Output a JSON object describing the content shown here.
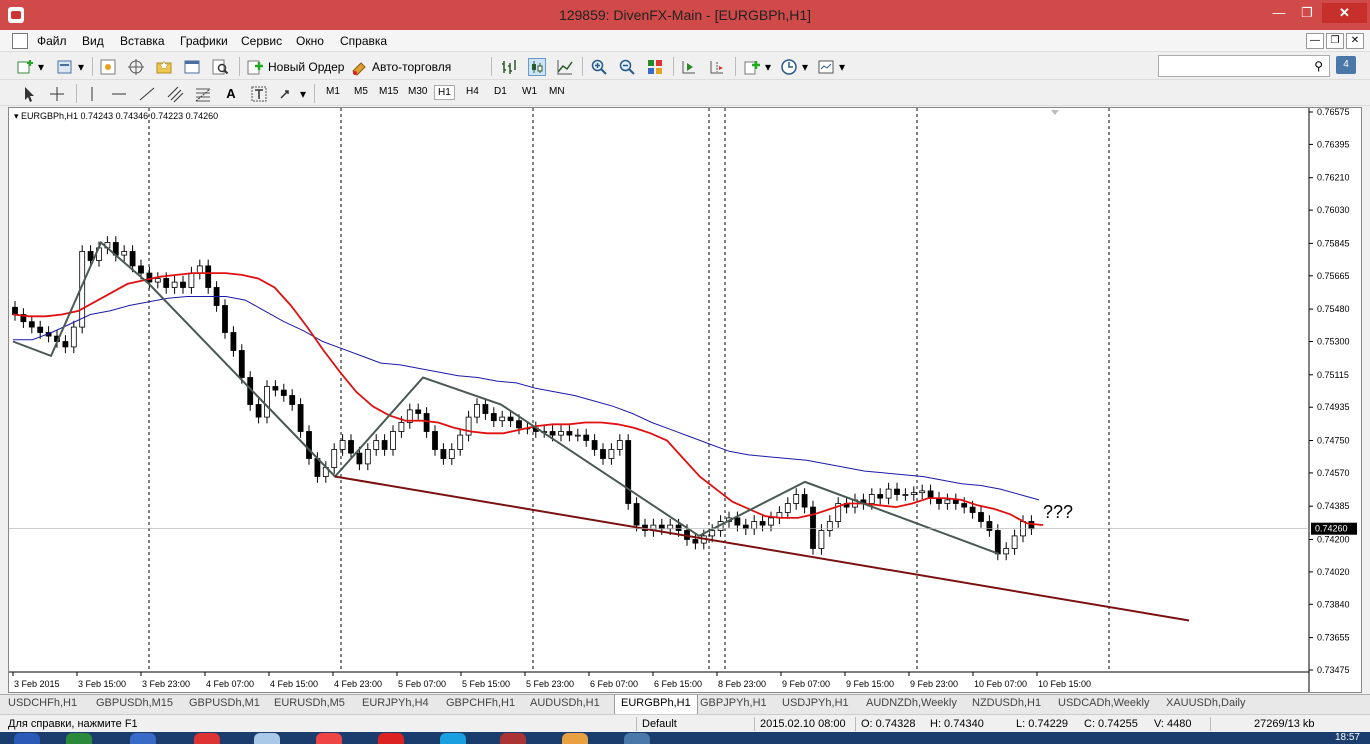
{
  "window": {
    "title": "129859: DivenFX-Main - [EURGBPh,H1]"
  },
  "menu": [
    "Файл",
    "Вид",
    "Вставка",
    "Графики",
    "Сервис",
    "Окно",
    "Справка"
  ],
  "toolbar": {
    "new_order": "Новый Ордер",
    "auto_trading": "Авто-торговля",
    "notification_count": "4"
  },
  "timeframes": [
    "M1",
    "M5",
    "M15",
    "M30",
    "H1",
    "H4",
    "D1",
    "W1",
    "MN"
  ],
  "active_timeframe": "H1",
  "chart_header": "EURGBPh,H1  0.74243 0.74346 0.74223 0.74260",
  "annotation": "???",
  "chart_data": {
    "type": "candlestick",
    "symbol": "EURGBPh,H1",
    "ohlc": {
      "open": 0.74243,
      "high": 0.74346,
      "low": 0.74223,
      "close": 0.7426
    },
    "current_price": 0.7426,
    "ylim": [
      0.73475,
      0.76575
    ],
    "yticks": [
      0.76575,
      0.76395,
      0.7621,
      0.7603,
      0.75845,
      0.75665,
      0.7548,
      0.753,
      0.75115,
      0.74935,
      0.7475,
      0.7457,
      0.74385,
      0.742,
      0.7402,
      0.7384,
      0.73655,
      0.73475
    ],
    "xticks": [
      "3 Feb 2015",
      "3 Feb 15:00",
      "3 Feb 23:00",
      "4 Feb 07:00",
      "4 Feb 15:00",
      "4 Feb 23:00",
      "5 Feb 07:00",
      "5 Feb 15:00",
      "5 Feb 23:00",
      "6 Feb 07:00",
      "6 Feb 15:00",
      "8 Feb 23:00",
      "9 Feb 07:00",
      "9 Feb 15:00",
      "9 Feb 23:00",
      "10 Feb 07:00",
      "10 Feb 15:00"
    ],
    "closes": [
      0.7545,
      0.7541,
      0.7538,
      0.7535,
      0.7533,
      0.753,
      0.7527,
      0.7538,
      0.758,
      0.7575,
      0.7582,
      0.7585,
      0.7578,
      0.758,
      0.7572,
      0.7568,
      0.7563,
      0.7565,
      0.756,
      0.7563,
      0.756,
      0.7568,
      0.7572,
      0.756,
      0.755,
      0.7535,
      0.7525,
      0.751,
      0.7495,
      0.7488,
      0.7505,
      0.7503,
      0.75,
      0.7495,
      0.748,
      0.7465,
      0.7455,
      0.746,
      0.747,
      0.7475,
      0.7468,
      0.7462,
      0.747,
      0.7475,
      0.747,
      0.748,
      0.7485,
      0.7492,
      0.749,
      0.748,
      0.747,
      0.7465,
      0.747,
      0.7478,
      0.7488,
      0.7495,
      0.749,
      0.7486,
      0.7488,
      0.7486,
      0.7482,
      0.7482,
      0.748,
      0.748,
      0.7478,
      0.748,
      0.7478,
      0.7478,
      0.7475,
      0.747,
      0.7465,
      0.747,
      0.7475,
      0.744,
      0.7428,
      0.7425,
      0.7428,
      0.7426,
      0.7428,
      0.7425,
      0.742,
      0.7418,
      0.7422,
      0.7425,
      0.743,
      0.7432,
      0.7428,
      0.7426,
      0.743,
      0.7428,
      0.7432,
      0.7435,
      0.744,
      0.7445,
      0.7438,
      0.7415,
      0.7425,
      0.743,
      0.744,
      0.7438,
      0.7442,
      0.744,
      0.7445,
      0.7443,
      0.7448,
      0.7445,
      0.7445,
      0.7446,
      0.7447,
      0.7443,
      0.744,
      0.7442,
      0.744,
      0.7438,
      0.7435,
      0.743,
      0.7425,
      0.7412,
      0.7415,
      0.7422,
      0.743,
      0.7426
    ],
    "ma_red": [
      0.7545,
      0.7544,
      0.7544,
      0.7545,
      0.7547,
      0.7552,
      0.7557,
      0.7562,
      0.7564,
      0.7566,
      0.7567,
      0.7568,
      0.7568,
      0.7568,
      0.7567,
      0.7565,
      0.756,
      0.755,
      0.7538,
      0.7525,
      0.7513,
      0.7502,
      0.7494,
      0.7489,
      0.7486,
      0.7486,
      0.7485,
      0.7482,
      0.748,
      0.7479,
      0.7479,
      0.7481,
      0.7483,
      0.7484,
      0.7484,
      0.7485,
      0.7485,
      0.7484,
      0.7482,
      0.7479,
      0.7475,
      0.7465,
      0.7455,
      0.7448,
      0.7441,
      0.7437,
      0.7433,
      0.7432,
      0.7432,
      0.7434,
      0.7437,
      0.744,
      0.744,
      0.7439,
      0.7438,
      0.744,
      0.7443,
      0.7443,
      0.7442,
      0.7439,
      0.7437,
      0.7434,
      0.7429,
      0.7428
    ],
    "ma_blue": [
      0.7531,
      0.7531,
      0.7535,
      0.754,
      0.7545,
      0.7547,
      0.755,
      0.7552,
      0.7554,
      0.7555,
      0.7555,
      0.7555,
      0.7553,
      0.7547,
      0.7541,
      0.7536,
      0.753,
      0.7526,
      0.7522,
      0.7518,
      0.7517,
      0.7515,
      0.7513,
      0.7511,
      0.751,
      0.7508,
      0.7507,
      0.7504,
      0.7502,
      0.75,
      0.7497,
      0.7494,
      0.749,
      0.7485,
      0.7481,
      0.7477,
      0.7473,
      0.7469,
      0.7467,
      0.7466,
      0.7465,
      0.7464,
      0.7462,
      0.746,
      0.7458,
      0.7457,
      0.7456,
      0.7455,
      0.7453,
      0.7451,
      0.745,
      0.7448,
      0.7445,
      0.7442
    ],
    "zigzag": [
      [
        0.753,
        0.7522
      ],
      [
        0.7585
      ],
      [
        0.7562
      ],
      [
        0.7455
      ],
      [
        0.751
      ],
      [
        0.7495
      ],
      [
        0.7422
      ],
      [
        0.7452
      ],
      [
        0.7412
      ]
    ],
    "trendline": [
      0.7455,
      0.7375
    ],
    "grid": false,
    "period_separators": true
  },
  "tabs": [
    "USDCHFh,H1",
    "GBPUSDh,M15",
    "GBPUSDh,M1",
    "EURUSDh,M5",
    "EURJPYh,H4",
    "GBPCHFh,H1",
    "AUDUSDh,H1",
    "EURGBPh,H1",
    "GBPJPYh,H1",
    "USDJPYh,H1",
    "AUDNZDh,Weekly",
    "NZDUSDh,H1",
    "USDCADh,Weekly",
    "XAUUSDh,Daily"
  ],
  "active_tab": "EURGBPh,H1",
  "status": {
    "help": "Для справки, нажмите F1",
    "profile": "Default",
    "datetime": "2015.02.10 08:00",
    "open": "O: 0.74328",
    "high": "H: 0.74340",
    "low": "L: 0.74229",
    "close": "C: 0.74255",
    "volume": "V: 4480",
    "traffic": "27269/13 kb"
  },
  "clock": "18:57"
}
